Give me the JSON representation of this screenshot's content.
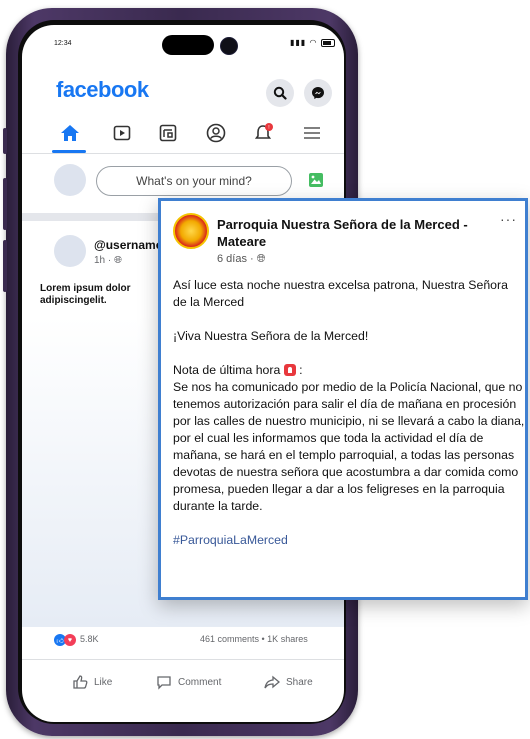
{
  "status_bar": {
    "time": "12:34"
  },
  "app": {
    "logo": "facebook",
    "brand_color": "#1877f2"
  },
  "header_icons": [
    "search-icon",
    "messenger-icon"
  ],
  "nav": {
    "items": [
      "home-icon",
      "watch-icon",
      "marketplace-icon",
      "profile-icon",
      "notifications-icon",
      "menu-icon"
    ],
    "active": "home-icon"
  },
  "composer": {
    "placeholder": "What's on your mind?"
  },
  "feed_post": {
    "username": "@username",
    "time": "1h · ",
    "text": "Lorem ipsum dolor adipiscingelit.",
    "reactions_count": "5.8K",
    "comments_shares": "461 comments  •  1K shares",
    "actions": {
      "like": "Like",
      "comment": "Comment",
      "share": "Share"
    }
  },
  "overlay_post": {
    "page_name": "Parroquia Nuestra Señora de la Merced - Mateare",
    "meta": "6 días · ",
    "paragraphs": [
      "Así luce esta noche nuestra excelsa patrona, Nuestra Señora de la Merced",
      "¡Viva Nuestra Señora de la Merced!",
      "Nota de última hora",
      "Se nos ha comunicado por medio de la Policía Nacional, que no tenemos autorización para salir el día de mañana en procesión por las calles de nuestro municipio, ni se llevará a cabo la diana, por el cual les informamos que toda la actividad el día de mañana, se hará en el templo parroquial, a todas las personas devotas de nuestra señora que acostumbra a dar comida como promesa, pueden llegar a dar a los feligreses en la parroquia durante la tarde.",
      "#ParroquiaLaMerced"
    ],
    "note_suffix": " :",
    "more": "···",
    "border_color": "#3f7fd0"
  }
}
